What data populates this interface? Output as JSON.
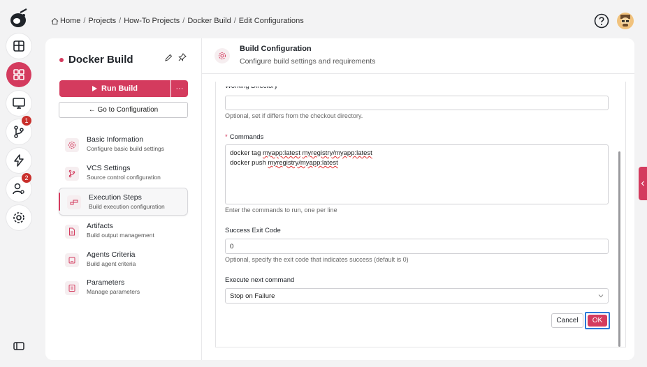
{
  "breadcrumb": [
    "Home",
    "Projects",
    "How-To Projects",
    "Docker Build",
    "Edit Configurations"
  ],
  "badges": {
    "vcs": "1",
    "users": "2"
  },
  "build": {
    "name": "Docker Build",
    "run_label": "Run Build",
    "more_label": "···",
    "goto_label": "← Go to Configuration"
  },
  "nav": [
    {
      "label": "Basic Information",
      "sub": "Configure basic build settings"
    },
    {
      "label": "VCS Settings",
      "sub": "Source control configuration"
    },
    {
      "label": "Execution Steps",
      "sub": "Build execution configuration"
    },
    {
      "label": "Artifacts",
      "sub": "Build output management"
    },
    {
      "label": "Agents Criteria",
      "sub": "Build agent criteria"
    },
    {
      "label": "Parameters",
      "sub": "Manage parameters"
    }
  ],
  "panel": {
    "title": "Build Configuration",
    "subtitle": "Configure build settings and requirements"
  },
  "form": {
    "workdir_label": "Working Directory",
    "workdir_value": "",
    "workdir_help": "Optional, set if differs from the checkout directory.",
    "commands_label": "Commands",
    "commands_line1_a": "docker tag ",
    "commands_line1_b": "myapp:latest",
    "commands_line1_c": " ",
    "commands_line1_d": "myregistry/myapp:latest",
    "commands_line2_a": "docker push ",
    "commands_line2_b": "myregistry/myapp:latest",
    "commands_help": "Enter the commands to run, one per line",
    "exit_label": "Success Exit Code",
    "exit_value": "0",
    "exit_help": "Optional, specify the exit code that indicates success (default is 0)",
    "next_label": "Execute next command",
    "next_value": "Stop on Failure",
    "cancel_label": "Cancel",
    "ok_label": "OK"
  },
  "colors": {
    "accent": "#d43b5e",
    "focus": "#2a78d8"
  }
}
